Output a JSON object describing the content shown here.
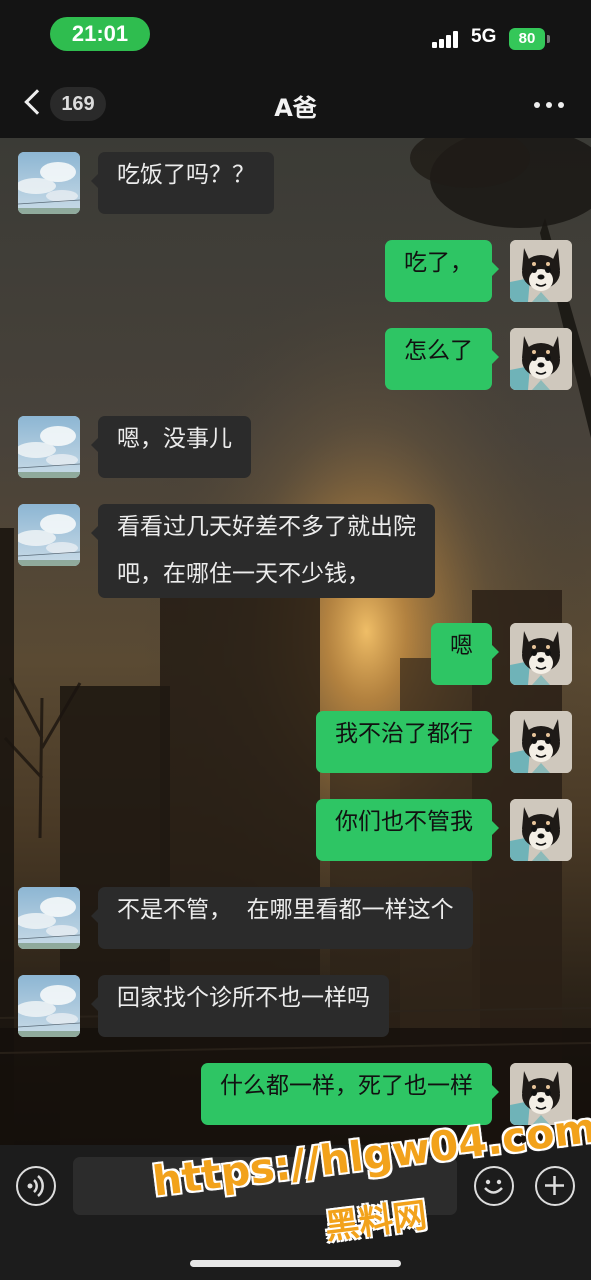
{
  "status_bar": {
    "time": "21:01",
    "network": "5G",
    "battery": "80"
  },
  "nav": {
    "back_count": "169",
    "title": "A爸",
    "more_icon": "more-dots-icon"
  },
  "messages": [
    {
      "side": "in",
      "text": "吃饭了吗？？"
    },
    {
      "side": "out",
      "text": "吃了，"
    },
    {
      "side": "out",
      "text": "怎么了"
    },
    {
      "side": "in",
      "text": "嗯，没事儿"
    },
    {
      "side": "in",
      "text": "看看过几天好差不多了就出院\n吧，在哪住一天不少钱，"
    },
    {
      "side": "out",
      "text": "嗯"
    },
    {
      "side": "out",
      "text": "我不治了都行"
    },
    {
      "side": "out",
      "text": "你们也不管我"
    },
    {
      "side": "in",
      "text": "不是不管，  在哪里看都一样这个"
    },
    {
      "side": "in",
      "text": "回家找个诊所不也一样吗"
    },
    {
      "side": "out",
      "text": "什么都一样，死了也一样"
    }
  ],
  "input_bar": {
    "input_value": "",
    "voice_icon": "voice-icon",
    "emoji_icon": "emoji-icon",
    "plus_icon": "plus-icon"
  },
  "watermark": {
    "url": "https://hlgw04.com",
    "site": "黑料网"
  },
  "colors": {
    "outgoing_bubble": "#2ec564",
    "incoming_bubble": "#2b2b2b",
    "time_pill": "#2fbd4f",
    "watermark": "#f2a21b"
  }
}
